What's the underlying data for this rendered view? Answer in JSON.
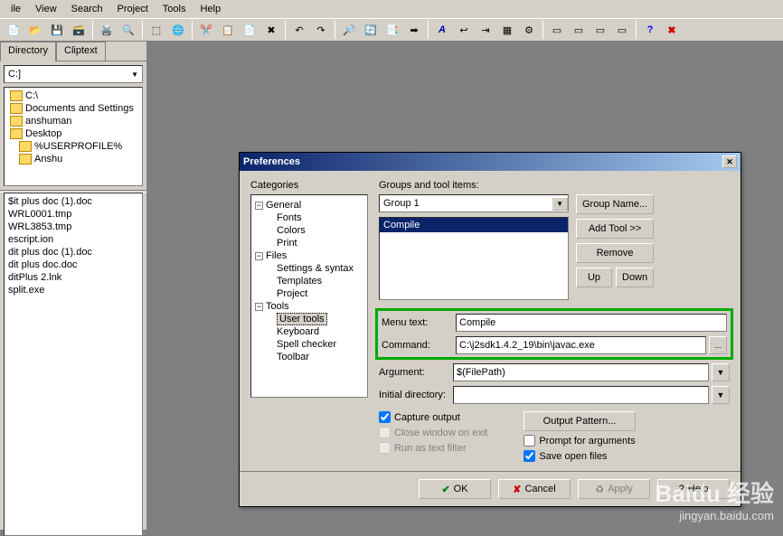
{
  "menubar": {
    "items": [
      "ile",
      "View",
      "Search",
      "Project",
      "Tools",
      "Help"
    ]
  },
  "sidebar": {
    "tabs": {
      "directory": "Directory",
      "cliptext": "Cliptext"
    },
    "drive": "C:]",
    "folders": [
      "C:\\",
      "Documents and Settings",
      "anshuman",
      "Desktop",
      "%USERPROFILE%",
      "Anshu"
    ],
    "files": [
      "$it plus doc (1).doc",
      "WRL0001.tmp",
      "WRL3853.tmp",
      "escript.ion",
      "dit plus doc (1).doc",
      "dit plus doc.doc",
      "ditPlus 2.lnk",
      "split.exe"
    ]
  },
  "dialog": {
    "title": "Preferences",
    "categories_label": "Categories",
    "groups_label": "Groups and tool items:",
    "tree": {
      "general": "General",
      "fonts": "Fonts",
      "colors": "Colors",
      "print": "Print",
      "files": "Files",
      "settings_syntax": "Settings & syntax",
      "templates": "Templates",
      "project": "Project",
      "tools": "Tools",
      "user_tools": "User tools",
      "keyboard": "Keyboard",
      "spell_checker": "Spell checker",
      "toolbar": "Toolbar"
    },
    "group_selected": "Group 1",
    "tool_selected": "Compile",
    "buttons": {
      "group_name": "Group Name...",
      "add_tool": "Add Tool >>",
      "remove": "Remove",
      "up": "Up",
      "down": "Down",
      "output_pattern": "Output Pattern...",
      "ok": "OK",
      "cancel": "Cancel",
      "apply": "Apply",
      "help": "Help"
    },
    "form": {
      "menu_text_label": "Menu text:",
      "menu_text_value": "Compile",
      "command_label": "Command:",
      "command_value": "C:\\j2sdk1.4.2_19\\bin\\javac.exe",
      "argument_label": "Argument:",
      "argument_value": "$(FilePath)",
      "initial_dir_label": "Initial directory:",
      "initial_dir_value": ""
    },
    "checks": {
      "capture_output": "Capture output",
      "close_on_exit": "Close window on exit",
      "run_text_filter": "Run as text filter",
      "prompt_args": "Prompt for arguments",
      "save_open": "Save open files"
    }
  },
  "watermark": {
    "brand": "Baidu 经验",
    "url": "jingyan.baidu.com"
  }
}
